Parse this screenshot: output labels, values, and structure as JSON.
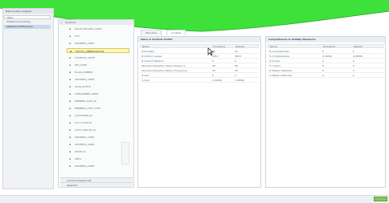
{
  "left_panel": {
    "header": "Data Quality Analysis",
    "items": [
      {
        "label": "Filter",
        "state": "selected"
      },
      {
        "label": "Statistical Summary",
        "state": "normal"
      },
      {
        "label": "Statistical Differences",
        "state": "active"
      }
    ]
  },
  "tree": {
    "header": "Columns",
    "items": [
      "POLICYHOLDER_CODE",
      "CITY",
      "ADDRESS_LINE1",
      "POSTAL_ABBREVIATION",
      "COUNTRY_CODE",
      "ZIP_CODE",
      "PLAN_NUMBER",
      "ADDRESS_LINE3",
      "PLAN_SUFFIX",
      "SUBSCRIBER_NAME",
      "MEMBER_DATE_ID",
      "MEMBER_CONT_TYPE",
      "CUSTOMER_ID",
      "ACCT_STATUS",
      "CUST_AND_RP_ID",
      "ADDRESS_LINE2",
      "ADDRESS_LINE4",
      "STATE_ID",
      "AREA",
      "ADDRESS_LINE5"
    ],
    "selected_index": 3,
    "groups": [
      "Current Analysis Set",
      "Selection"
    ]
  },
  "tabs": [
    {
      "label": "Structure",
      "active": false
    },
    {
      "label": "Content",
      "active": true
    }
  ],
  "value_profile": {
    "title": "Value & Content Profile",
    "columns": [
      "Name",
      "Procedure",
      "Results"
    ],
    "rows": [
      [
        "Cardinality",
        "45",
        "45"
      ],
      [
        "# distinct values",
        "4012",
        "4018"
      ],
      [
        "# distinct Patterns",
        "9",
        "9"
      ],
      [
        "Standard Deviation Value Frequency",
        "98",
        "98"
      ],
      [
        "Standard Deviation Pattern Frequency",
        "45",
        "45"
      ],
      [
        "# Null",
        "0",
        "0"
      ],
      [
        "% Null",
        "1.00000",
        "1.00000"
      ]
    ]
  },
  "completeness": {
    "title": "Completeness & Validity Measures",
    "columns": [
      "Name",
      "Procedure",
      "Results"
    ],
    "rows": [
      [
        "# Completeness",
        "0",
        "0"
      ],
      [
        "% Completeness",
        "0.00000",
        "0.00000"
      ],
      [
        "# Invalid",
        "0",
        "0"
      ],
      [
        "% Invalid",
        "0",
        "0"
      ],
      [
        "# Pattern Matched",
        "0",
        "0"
      ],
      [
        "% Pattern Matched",
        "0",
        "0"
      ]
    ]
  },
  "colors": {
    "banner": "#3ee13a",
    "accent_green": "#86c95a",
    "selection_yellow": "#fff8b4",
    "active_blue": "#c8d9ea"
  },
  "icons": {
    "cursor": "mouse-pointer-icon",
    "tree_bullet": "bullet-icon",
    "tree_expand": "expand-icon"
  }
}
